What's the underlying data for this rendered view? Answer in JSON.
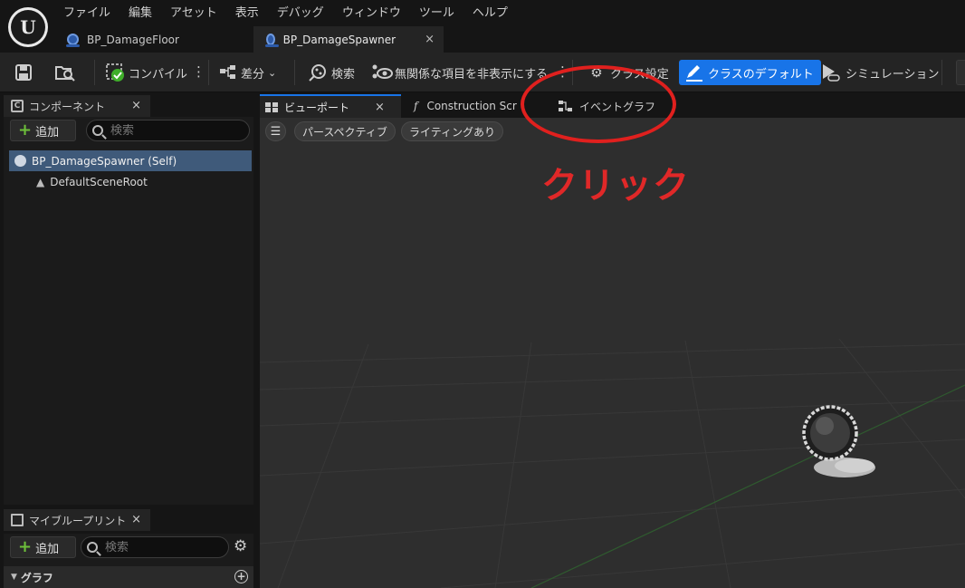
{
  "menu": [
    "ファイル",
    "編集",
    "アセット",
    "表示",
    "デバッグ",
    "ウィンドウ",
    "ツール",
    "ヘルプ"
  ],
  "logo": {
    "glyph": "U"
  },
  "doc_tabs": [
    {
      "label": "BP_DamageFloor",
      "active": false
    },
    {
      "label": "BP_DamageSpawner",
      "active": true,
      "close": "×"
    }
  ],
  "toolbar": {
    "compile": "コンパイル",
    "diff": "差分",
    "search": "検索",
    "hide_unrelated": "無関係な項目を非表示にする",
    "class_settings": "クラス設定",
    "class_defaults": "クラスのデフォルト",
    "simulation": "シミュレーション",
    "kebab": "⋮",
    "icons": {
      "save": "save-icon",
      "browse": "browse-icon",
      "compile": "compile-icon",
      "diff": "diff-icon",
      "search": "search-icon",
      "hide": "hide-icon",
      "settings": "gear-icon",
      "defaults": "edit-icon",
      "simulation": "simulation-icon"
    }
  },
  "components_panel": {
    "title": "コンポーネント",
    "add": "追加",
    "search_placeholder": "検索",
    "close": "×",
    "tree": [
      {
        "label": "BP_DamageSpawner (Self)",
        "selected": true
      },
      {
        "label": "DefaultSceneRoot",
        "selected": false
      }
    ]
  },
  "my_blueprint_panel": {
    "title": "マイブループリント",
    "add": "追加",
    "search_placeholder": "検索",
    "close": "×",
    "section": "グラフ"
  },
  "editor_tabs": [
    {
      "label": "ビューポート",
      "active": true,
      "close": "×"
    },
    {
      "label": "Construction Scr",
      "active": false
    },
    {
      "label": "イベントグラフ",
      "active": false
    }
  ],
  "viewport": {
    "perspective": "パースペクティブ",
    "lighting": "ライティングあり"
  },
  "annotation": {
    "text": "クリック",
    "color": "#e02828",
    "target": "イベントグラフ"
  },
  "colors": {
    "accent": "#1874e8",
    "selected": "#3f5a7a",
    "add_plus": "#6dbf3a"
  }
}
